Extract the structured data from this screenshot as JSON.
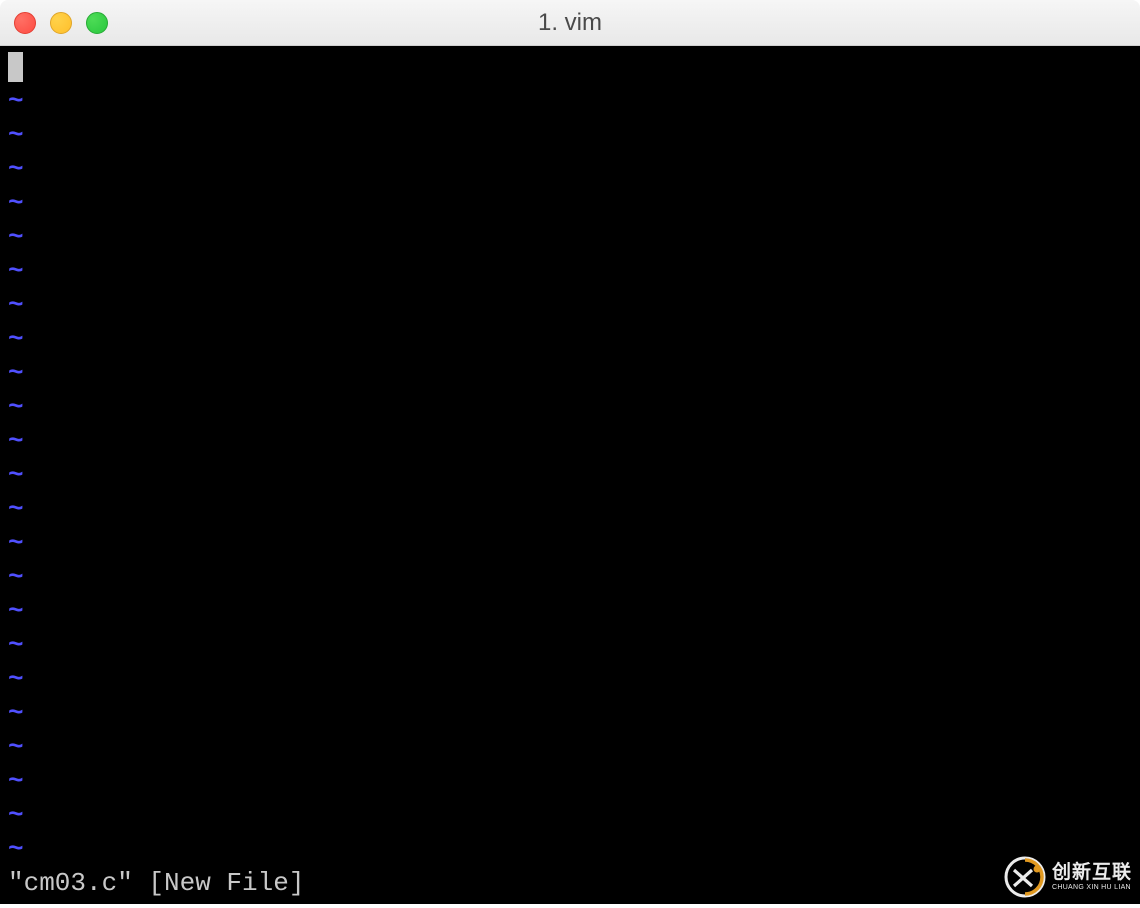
{
  "window": {
    "title": "1. vim"
  },
  "editor": {
    "cursor_char": " ",
    "tilde": "~",
    "empty_line_count": 23,
    "status_line": "\"cm03.c\" [New File]"
  },
  "watermark": {
    "cn": "创新互联",
    "en": "CHUANG XIN HU LIAN"
  }
}
